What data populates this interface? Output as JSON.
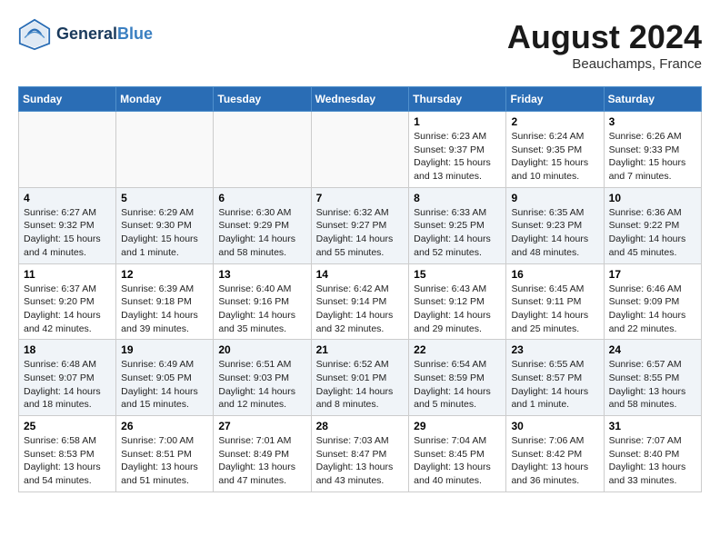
{
  "header": {
    "logo_line1": "General",
    "logo_line2": "Blue",
    "month": "August 2024",
    "location": "Beauchamps, France"
  },
  "days_of_week": [
    "Sunday",
    "Monday",
    "Tuesday",
    "Wednesday",
    "Thursday",
    "Friday",
    "Saturday"
  ],
  "weeks": [
    [
      {
        "day": "",
        "sunrise": "",
        "sunset": "",
        "daylight": ""
      },
      {
        "day": "",
        "sunrise": "",
        "sunset": "",
        "daylight": ""
      },
      {
        "day": "",
        "sunrise": "",
        "sunset": "",
        "daylight": ""
      },
      {
        "day": "",
        "sunrise": "",
        "sunset": "",
        "daylight": ""
      },
      {
        "day": "1",
        "sunrise": "Sunrise: 6:23 AM",
        "sunset": "Sunset: 9:37 PM",
        "daylight": "Daylight: 15 hours and 13 minutes."
      },
      {
        "day": "2",
        "sunrise": "Sunrise: 6:24 AM",
        "sunset": "Sunset: 9:35 PM",
        "daylight": "Daylight: 15 hours and 10 minutes."
      },
      {
        "day": "3",
        "sunrise": "Sunrise: 6:26 AM",
        "sunset": "Sunset: 9:33 PM",
        "daylight": "Daylight: 15 hours and 7 minutes."
      }
    ],
    [
      {
        "day": "4",
        "sunrise": "Sunrise: 6:27 AM",
        "sunset": "Sunset: 9:32 PM",
        "daylight": "Daylight: 15 hours and 4 minutes."
      },
      {
        "day": "5",
        "sunrise": "Sunrise: 6:29 AM",
        "sunset": "Sunset: 9:30 PM",
        "daylight": "Daylight: 15 hours and 1 minute."
      },
      {
        "day": "6",
        "sunrise": "Sunrise: 6:30 AM",
        "sunset": "Sunset: 9:29 PM",
        "daylight": "Daylight: 14 hours and 58 minutes."
      },
      {
        "day": "7",
        "sunrise": "Sunrise: 6:32 AM",
        "sunset": "Sunset: 9:27 PM",
        "daylight": "Daylight: 14 hours and 55 minutes."
      },
      {
        "day": "8",
        "sunrise": "Sunrise: 6:33 AM",
        "sunset": "Sunset: 9:25 PM",
        "daylight": "Daylight: 14 hours and 52 minutes."
      },
      {
        "day": "9",
        "sunrise": "Sunrise: 6:35 AM",
        "sunset": "Sunset: 9:23 PM",
        "daylight": "Daylight: 14 hours and 48 minutes."
      },
      {
        "day": "10",
        "sunrise": "Sunrise: 6:36 AM",
        "sunset": "Sunset: 9:22 PM",
        "daylight": "Daylight: 14 hours and 45 minutes."
      }
    ],
    [
      {
        "day": "11",
        "sunrise": "Sunrise: 6:37 AM",
        "sunset": "Sunset: 9:20 PM",
        "daylight": "Daylight: 14 hours and 42 minutes."
      },
      {
        "day": "12",
        "sunrise": "Sunrise: 6:39 AM",
        "sunset": "Sunset: 9:18 PM",
        "daylight": "Daylight: 14 hours and 39 minutes."
      },
      {
        "day": "13",
        "sunrise": "Sunrise: 6:40 AM",
        "sunset": "Sunset: 9:16 PM",
        "daylight": "Daylight: 14 hours and 35 minutes."
      },
      {
        "day": "14",
        "sunrise": "Sunrise: 6:42 AM",
        "sunset": "Sunset: 9:14 PM",
        "daylight": "Daylight: 14 hours and 32 minutes."
      },
      {
        "day": "15",
        "sunrise": "Sunrise: 6:43 AM",
        "sunset": "Sunset: 9:12 PM",
        "daylight": "Daylight: 14 hours and 29 minutes."
      },
      {
        "day": "16",
        "sunrise": "Sunrise: 6:45 AM",
        "sunset": "Sunset: 9:11 PM",
        "daylight": "Daylight: 14 hours and 25 minutes."
      },
      {
        "day": "17",
        "sunrise": "Sunrise: 6:46 AM",
        "sunset": "Sunset: 9:09 PM",
        "daylight": "Daylight: 14 hours and 22 minutes."
      }
    ],
    [
      {
        "day": "18",
        "sunrise": "Sunrise: 6:48 AM",
        "sunset": "Sunset: 9:07 PM",
        "daylight": "Daylight: 14 hours and 18 minutes."
      },
      {
        "day": "19",
        "sunrise": "Sunrise: 6:49 AM",
        "sunset": "Sunset: 9:05 PM",
        "daylight": "Daylight: 14 hours and 15 minutes."
      },
      {
        "day": "20",
        "sunrise": "Sunrise: 6:51 AM",
        "sunset": "Sunset: 9:03 PM",
        "daylight": "Daylight: 14 hours and 12 minutes."
      },
      {
        "day": "21",
        "sunrise": "Sunrise: 6:52 AM",
        "sunset": "Sunset: 9:01 PM",
        "daylight": "Daylight: 14 hours and 8 minutes."
      },
      {
        "day": "22",
        "sunrise": "Sunrise: 6:54 AM",
        "sunset": "Sunset: 8:59 PM",
        "daylight": "Daylight: 14 hours and 5 minutes."
      },
      {
        "day": "23",
        "sunrise": "Sunrise: 6:55 AM",
        "sunset": "Sunset: 8:57 PM",
        "daylight": "Daylight: 14 hours and 1 minute."
      },
      {
        "day": "24",
        "sunrise": "Sunrise: 6:57 AM",
        "sunset": "Sunset: 8:55 PM",
        "daylight": "Daylight: 13 hours and 58 minutes."
      }
    ],
    [
      {
        "day": "25",
        "sunrise": "Sunrise: 6:58 AM",
        "sunset": "Sunset: 8:53 PM",
        "daylight": "Daylight: 13 hours and 54 minutes."
      },
      {
        "day": "26",
        "sunrise": "Sunrise: 7:00 AM",
        "sunset": "Sunset: 8:51 PM",
        "daylight": "Daylight: 13 hours and 51 minutes."
      },
      {
        "day": "27",
        "sunrise": "Sunrise: 7:01 AM",
        "sunset": "Sunset: 8:49 PM",
        "daylight": "Daylight: 13 hours and 47 minutes."
      },
      {
        "day": "28",
        "sunrise": "Sunrise: 7:03 AM",
        "sunset": "Sunset: 8:47 PM",
        "daylight": "Daylight: 13 hours and 43 minutes."
      },
      {
        "day": "29",
        "sunrise": "Sunrise: 7:04 AM",
        "sunset": "Sunset: 8:45 PM",
        "daylight": "Daylight: 13 hours and 40 minutes."
      },
      {
        "day": "30",
        "sunrise": "Sunrise: 7:06 AM",
        "sunset": "Sunset: 8:42 PM",
        "daylight": "Daylight: 13 hours and 36 minutes."
      },
      {
        "day": "31",
        "sunrise": "Sunrise: 7:07 AM",
        "sunset": "Sunset: 8:40 PM",
        "daylight": "Daylight: 13 hours and 33 minutes."
      }
    ]
  ]
}
